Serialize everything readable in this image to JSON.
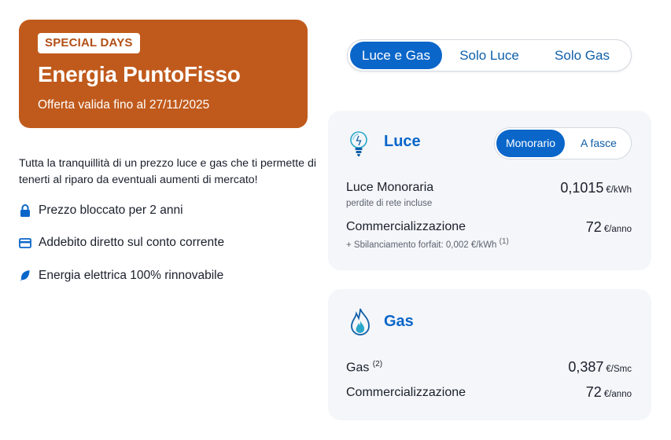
{
  "offer": {
    "badge": "SPECIAL DAYS",
    "title": "Energia PuntoFisso",
    "validity": "Offerta valida fino al 27/11/2025",
    "color": "#c05a1c"
  },
  "intro": "Tutta la tranquillità di un prezzo luce e gas che ti permette di tenerti al riparo da eventuali aumenti di mercato!",
  "features": [
    {
      "icon": "lock-icon",
      "label": "Prezzo bloccato per 2 anni"
    },
    {
      "icon": "credit-card-icon",
      "label": "Addebito diretto sul conto corrente"
    },
    {
      "icon": "leaf-icon",
      "label": "Energia elettrica 100% rinnovabile"
    }
  ],
  "tabs": {
    "items": [
      "Luce e Gas",
      "Solo Luce",
      "Solo Gas"
    ],
    "active": "Luce e Gas"
  },
  "luce": {
    "title": "Luce",
    "icon": "lightbulb-icon",
    "toggle": {
      "options": [
        "Monorario",
        "A fasce"
      ],
      "active": "Monorario"
    },
    "rows": [
      {
        "label": "Luce Monoraria",
        "note": "perdite di rete incluse",
        "price": "0,1015",
        "unit": "€/kWh"
      },
      {
        "label": "Commercializzazione",
        "note": "+ Sbilanciamento forfait: 0,002 €/kWh",
        "note_sup": "(1)",
        "price": "72",
        "unit": "€/anno"
      }
    ]
  },
  "gas": {
    "title": "Gas",
    "icon": "flame-icon",
    "rows": [
      {
        "label": "Gas",
        "label_sup": "(2)",
        "price": "0,387",
        "unit": "€/Smc"
      },
      {
        "label": "Commercializzazione",
        "price": "72",
        "unit": "€/anno"
      }
    ]
  },
  "colors": {
    "accent": "#0a66c9",
    "card_bg": "#f4f6f9"
  }
}
